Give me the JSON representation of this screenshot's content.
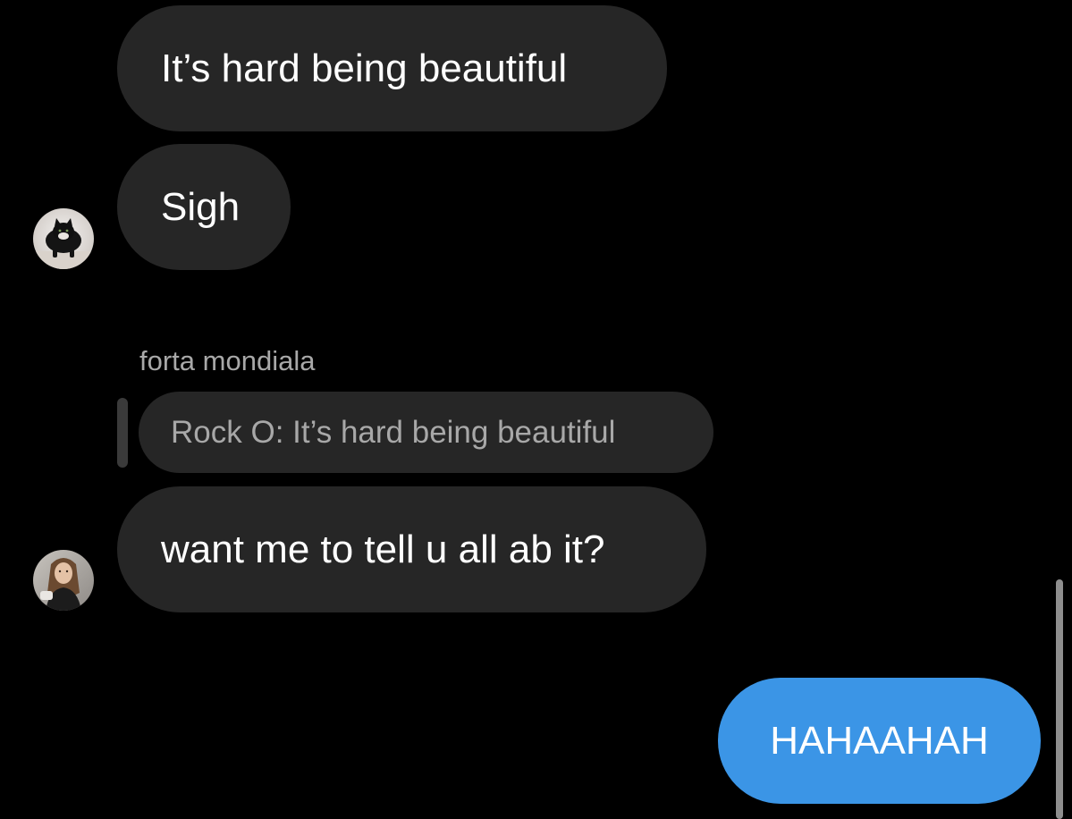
{
  "messages": {
    "msg1": "It’s hard being beautiful",
    "msg2": "Sigh",
    "reply_sender": "forta mondiala",
    "reply_quote": "Rock O: It’s hard being beautiful",
    "msg3": "want me to tell u all ab it?",
    "outgoing": "HAHAAHAH"
  },
  "colors": {
    "background": "#000000",
    "incoming_bubble": "#262626",
    "outgoing_bubble": "#3b95e6",
    "secondary_text": "#a8a8a8"
  }
}
